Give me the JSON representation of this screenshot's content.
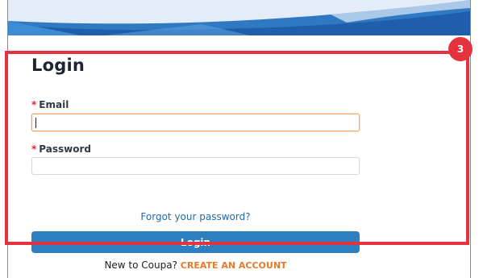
{
  "form": {
    "title": "Login",
    "required_marker": "*",
    "email_label": "Email",
    "email_value": "",
    "password_label": "Password",
    "password_value": "",
    "forgot_link": "Forgot your password?",
    "login_button": "Login",
    "signup_prompt": "New to Coupa?",
    "signup_link": "CREATE AN ACCOUNT"
  },
  "annotation": {
    "step_number": "3",
    "color": "#e5323f"
  },
  "colors": {
    "primary_button": "#2e7fc0",
    "link": "#2569a6",
    "signup_accent": "#e8782a",
    "required": "#d8262d",
    "focused_border": "#f0a868"
  }
}
